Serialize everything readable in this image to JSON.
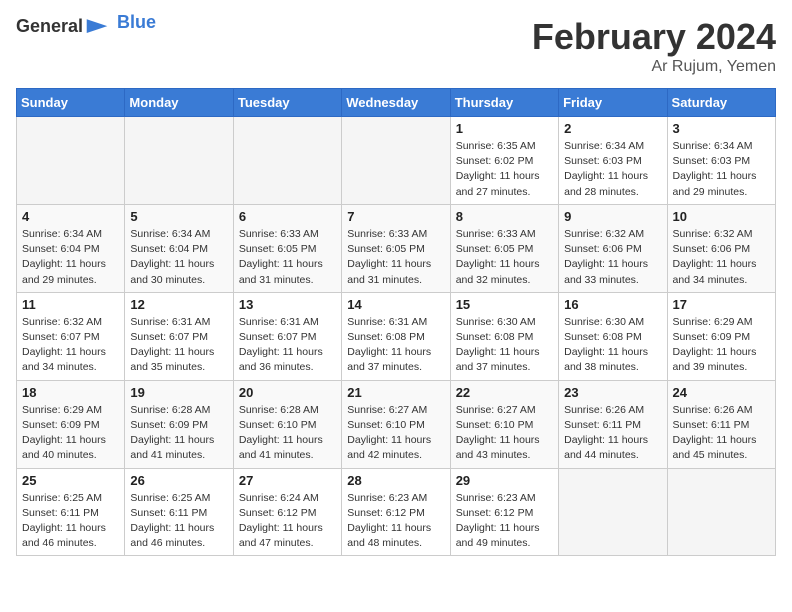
{
  "logo": {
    "general": "General",
    "blue": "Blue"
  },
  "title": "February 2024",
  "location": "Ar Rujum, Yemen",
  "days_of_week": [
    "Sunday",
    "Monday",
    "Tuesday",
    "Wednesday",
    "Thursday",
    "Friday",
    "Saturday"
  ],
  "weeks": [
    [
      {
        "num": "",
        "info": ""
      },
      {
        "num": "",
        "info": ""
      },
      {
        "num": "",
        "info": ""
      },
      {
        "num": "",
        "info": ""
      },
      {
        "num": "1",
        "info": "Sunrise: 6:35 AM\nSunset: 6:02 PM\nDaylight: 11 hours and 27 minutes."
      },
      {
        "num": "2",
        "info": "Sunrise: 6:34 AM\nSunset: 6:03 PM\nDaylight: 11 hours and 28 minutes."
      },
      {
        "num": "3",
        "info": "Sunrise: 6:34 AM\nSunset: 6:03 PM\nDaylight: 11 hours and 29 minutes."
      }
    ],
    [
      {
        "num": "4",
        "info": "Sunrise: 6:34 AM\nSunset: 6:04 PM\nDaylight: 11 hours and 29 minutes."
      },
      {
        "num": "5",
        "info": "Sunrise: 6:34 AM\nSunset: 6:04 PM\nDaylight: 11 hours and 30 minutes."
      },
      {
        "num": "6",
        "info": "Sunrise: 6:33 AM\nSunset: 6:05 PM\nDaylight: 11 hours and 31 minutes."
      },
      {
        "num": "7",
        "info": "Sunrise: 6:33 AM\nSunset: 6:05 PM\nDaylight: 11 hours and 31 minutes."
      },
      {
        "num": "8",
        "info": "Sunrise: 6:33 AM\nSunset: 6:05 PM\nDaylight: 11 hours and 32 minutes."
      },
      {
        "num": "9",
        "info": "Sunrise: 6:32 AM\nSunset: 6:06 PM\nDaylight: 11 hours and 33 minutes."
      },
      {
        "num": "10",
        "info": "Sunrise: 6:32 AM\nSunset: 6:06 PM\nDaylight: 11 hours and 34 minutes."
      }
    ],
    [
      {
        "num": "11",
        "info": "Sunrise: 6:32 AM\nSunset: 6:07 PM\nDaylight: 11 hours and 34 minutes."
      },
      {
        "num": "12",
        "info": "Sunrise: 6:31 AM\nSunset: 6:07 PM\nDaylight: 11 hours and 35 minutes."
      },
      {
        "num": "13",
        "info": "Sunrise: 6:31 AM\nSunset: 6:07 PM\nDaylight: 11 hours and 36 minutes."
      },
      {
        "num": "14",
        "info": "Sunrise: 6:31 AM\nSunset: 6:08 PM\nDaylight: 11 hours and 37 minutes."
      },
      {
        "num": "15",
        "info": "Sunrise: 6:30 AM\nSunset: 6:08 PM\nDaylight: 11 hours and 37 minutes."
      },
      {
        "num": "16",
        "info": "Sunrise: 6:30 AM\nSunset: 6:08 PM\nDaylight: 11 hours and 38 minutes."
      },
      {
        "num": "17",
        "info": "Sunrise: 6:29 AM\nSunset: 6:09 PM\nDaylight: 11 hours and 39 minutes."
      }
    ],
    [
      {
        "num": "18",
        "info": "Sunrise: 6:29 AM\nSunset: 6:09 PM\nDaylight: 11 hours and 40 minutes."
      },
      {
        "num": "19",
        "info": "Sunrise: 6:28 AM\nSunset: 6:09 PM\nDaylight: 11 hours and 41 minutes."
      },
      {
        "num": "20",
        "info": "Sunrise: 6:28 AM\nSunset: 6:10 PM\nDaylight: 11 hours and 41 minutes."
      },
      {
        "num": "21",
        "info": "Sunrise: 6:27 AM\nSunset: 6:10 PM\nDaylight: 11 hours and 42 minutes."
      },
      {
        "num": "22",
        "info": "Sunrise: 6:27 AM\nSunset: 6:10 PM\nDaylight: 11 hours and 43 minutes."
      },
      {
        "num": "23",
        "info": "Sunrise: 6:26 AM\nSunset: 6:11 PM\nDaylight: 11 hours and 44 minutes."
      },
      {
        "num": "24",
        "info": "Sunrise: 6:26 AM\nSunset: 6:11 PM\nDaylight: 11 hours and 45 minutes."
      }
    ],
    [
      {
        "num": "25",
        "info": "Sunrise: 6:25 AM\nSunset: 6:11 PM\nDaylight: 11 hours and 46 minutes."
      },
      {
        "num": "26",
        "info": "Sunrise: 6:25 AM\nSunset: 6:11 PM\nDaylight: 11 hours and 46 minutes."
      },
      {
        "num": "27",
        "info": "Sunrise: 6:24 AM\nSunset: 6:12 PM\nDaylight: 11 hours and 47 minutes."
      },
      {
        "num": "28",
        "info": "Sunrise: 6:23 AM\nSunset: 6:12 PM\nDaylight: 11 hours and 48 minutes."
      },
      {
        "num": "29",
        "info": "Sunrise: 6:23 AM\nSunset: 6:12 PM\nDaylight: 11 hours and 49 minutes."
      },
      {
        "num": "",
        "info": ""
      },
      {
        "num": "",
        "info": ""
      }
    ]
  ]
}
